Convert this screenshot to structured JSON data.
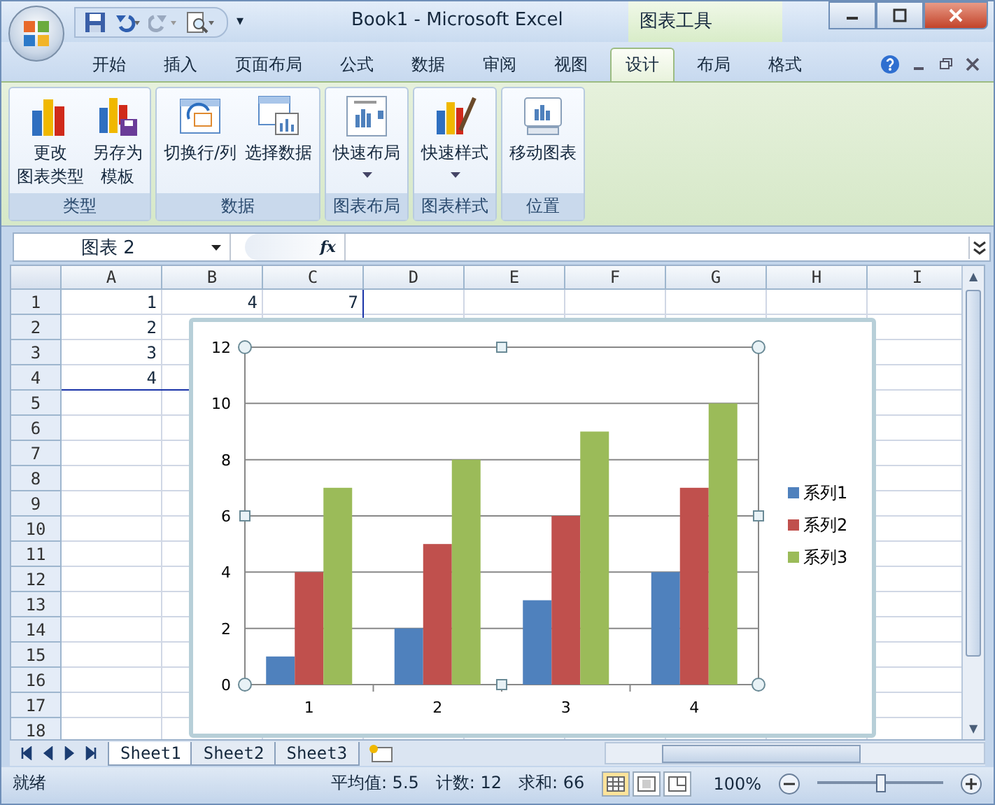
{
  "window": {
    "title": "Book1 - Microsoft Excel",
    "context_title": "图表工具"
  },
  "quick_access": {
    "customize": "▾"
  },
  "tabs": [
    {
      "label": "开始",
      "selected": false
    },
    {
      "label": "插入",
      "selected": false
    },
    {
      "label": "页面布局",
      "selected": false
    },
    {
      "label": "公式",
      "selected": false
    },
    {
      "label": "数据",
      "selected": false
    },
    {
      "label": "审阅",
      "selected": false
    },
    {
      "label": "视图",
      "selected": false
    },
    {
      "label": "设计",
      "selected": true
    },
    {
      "label": "布局",
      "selected": false
    },
    {
      "label": "格式",
      "selected": false
    }
  ],
  "ribbon_groups": [
    {
      "label": "类型",
      "buttons": [
        {
          "lines": [
            "更改",
            "图表类型"
          ],
          "dropdown": false
        },
        {
          "lines": [
            "另存为",
            "模板"
          ],
          "dropdown": false
        }
      ]
    },
    {
      "label": "数据",
      "buttons": [
        {
          "lines": [
            "切换行/列"
          ],
          "dropdown": false
        },
        {
          "lines": [
            "选择数据"
          ],
          "dropdown": false
        }
      ]
    },
    {
      "label": "图表布局",
      "buttons": [
        {
          "lines": [
            "快速布局"
          ],
          "dropdown": true
        }
      ]
    },
    {
      "label": "图表样式",
      "buttons": [
        {
          "lines": [
            "快速样式"
          ],
          "dropdown": true
        }
      ]
    },
    {
      "label": "位置",
      "buttons": [
        {
          "lines": [
            "移动图表"
          ],
          "dropdown": false
        }
      ]
    }
  ],
  "formula_bar": {
    "name_box": "图表 2",
    "function_label": "fx"
  },
  "sheet": {
    "columns": [
      "A",
      "B",
      "C",
      "D",
      "E",
      "F",
      "G",
      "H",
      "I"
    ],
    "rows": [
      {
        "label": "1",
        "values": [
          "1",
          "4",
          "7"
        ]
      },
      {
        "label": "2",
        "values": [
          "2"
        ]
      },
      {
        "label": "3",
        "values": [
          "3"
        ]
      },
      {
        "label": "4",
        "values": [
          "4"
        ]
      },
      {
        "label": "5",
        "values": []
      },
      {
        "label": "6",
        "values": []
      },
      {
        "label": "7",
        "values": []
      },
      {
        "label": "8",
        "values": []
      },
      {
        "label": "9",
        "values": []
      },
      {
        "label": "10",
        "values": []
      },
      {
        "label": "11",
        "values": []
      },
      {
        "label": "12",
        "values": []
      },
      {
        "label": "13",
        "values": []
      },
      {
        "label": "14",
        "values": []
      },
      {
        "label": "15",
        "values": []
      },
      {
        "label": "16",
        "values": []
      },
      {
        "label": "17",
        "values": []
      },
      {
        "label": "18",
        "values": []
      }
    ]
  },
  "chart": {
    "chart_data": {
      "type": "bar",
      "categories": [
        "1",
        "2",
        "3",
        "4"
      ],
      "series": [
        {
          "name": "系列1",
          "color": "#4f81bd",
          "values": [
            1,
            2,
            3,
            4
          ]
        },
        {
          "name": "系列2",
          "color": "#c0504d",
          "values": [
            4,
            5,
            6,
            7
          ]
        },
        {
          "name": "系列3",
          "color": "#9bbb59",
          "values": [
            7,
            8,
            9,
            10
          ]
        }
      ],
      "ylim": [
        0,
        12
      ],
      "yticks": [
        0,
        2,
        4,
        6,
        8,
        10,
        12
      ],
      "grid": true,
      "legend": "right"
    }
  },
  "scrollbar": {
    "up": "▲",
    "down": "▼"
  },
  "sheet_tabs": [
    {
      "label": "Sheet1",
      "selected": true
    },
    {
      "label": "Sheet2",
      "selected": false
    },
    {
      "label": "Sheet3",
      "selected": false
    }
  ],
  "status_bar": {
    "status": "就绪",
    "average": "平均值: 5.5",
    "count": "计数: 12",
    "sum": "求和: 66",
    "zoom": "100%",
    "zoom_slider": {
      "level": 0.5
    }
  }
}
